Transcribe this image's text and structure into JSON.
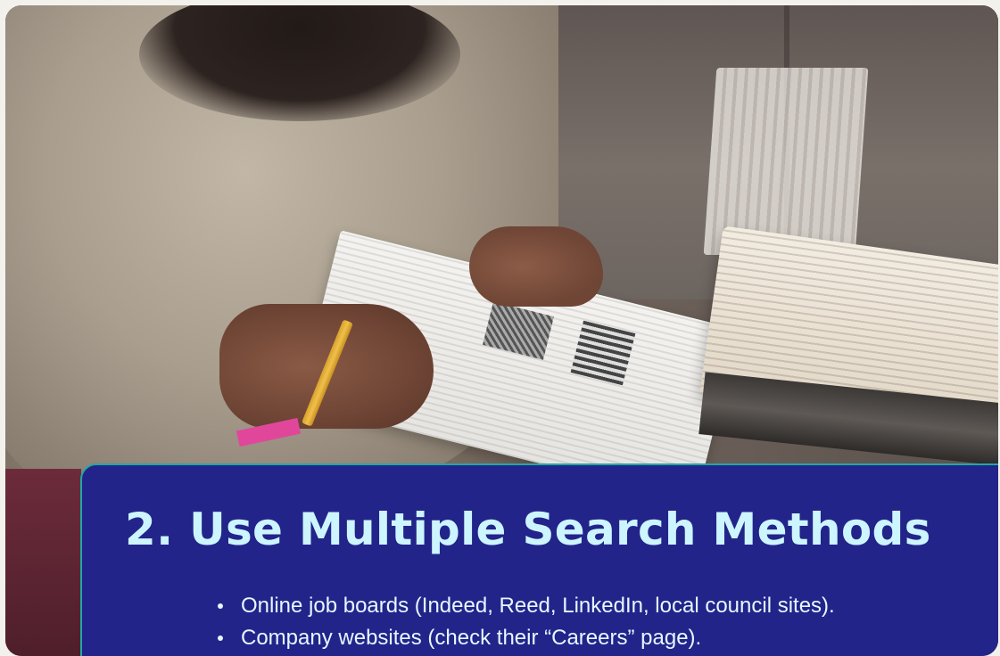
{
  "slide": {
    "title": "2. Use Multiple Search Methods",
    "bullets": [
      "Online job boards (Indeed, Reed, LinkedIn, local council sites).",
      "Company websites (check their “Careers” page)."
    ],
    "colors": {
      "card_background": "#23248a",
      "card_border": "#23a7a2",
      "title_text": "#cdf5ff",
      "bullet_text": "#e6f8ff"
    }
  }
}
